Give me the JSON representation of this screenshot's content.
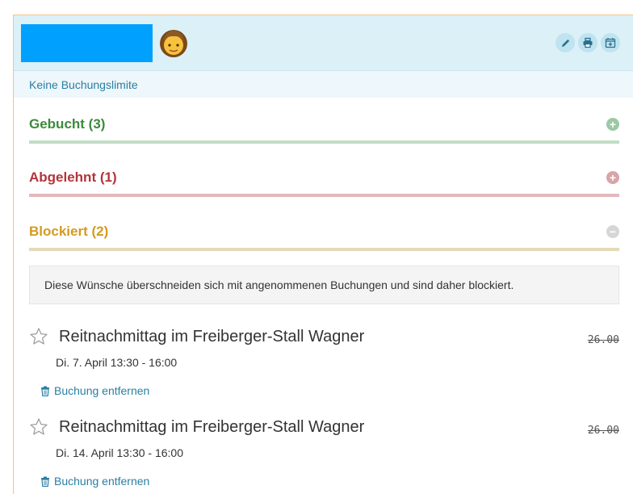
{
  "header": {
    "user_name": "",
    "icons": [
      "pencil-icon",
      "print-icon",
      "calendar-add-icon"
    ]
  },
  "limit_text": "Keine Buchungslimite",
  "sections": {
    "booked": {
      "label": "Gebucht (3)",
      "toggle": "+"
    },
    "rejected": {
      "label": "Abgelehnt (1)",
      "toggle": "+"
    },
    "blocked": {
      "label": "Blockiert (2)",
      "toggle": "−"
    }
  },
  "blocked_notice": "Diese Wünsche überschneiden sich mit angenommenen Buchungen und sind daher blockiert.",
  "blocked_items": [
    {
      "title": "Reitnachmittag im Freiberger-Stall Wagner",
      "date": "Di. 7. April 13:30 - 16:00",
      "price": "26.00",
      "remove_label": "Buchung entfernen"
    },
    {
      "title": "Reitnachmittag im Freiberger-Stall Wagner",
      "date": "Di. 14. April 13:30 - 16:00",
      "price": "26.00",
      "remove_label": "Buchung entfernen"
    }
  ],
  "colors": {
    "header_bg": "#dcf0f7",
    "name_block": "#00a0ff",
    "link": "#2a7ea2",
    "booked": "#3c8a3c",
    "rejected": "#b3343a",
    "blocked": "#d49a20"
  }
}
